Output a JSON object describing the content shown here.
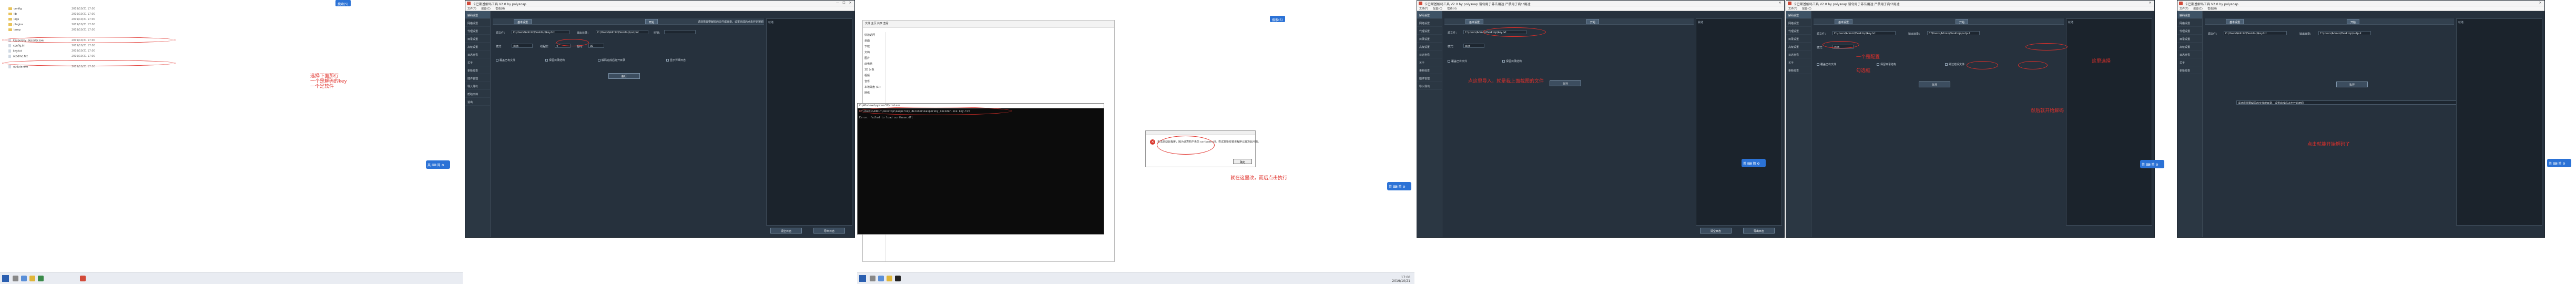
{
  "app": {
    "title": "卡巴斯基解码工具 V2.0 by polysoap",
    "title_alt": "卡巴斯基解码工具 V2.0 by polysoap    请勿用于非法用途 严禁用于商业用途",
    "menu": [
      "文件(F)",
      "配置(C)",
      "帮助(H)"
    ],
    "window_controls": [
      "—",
      "☐",
      "✕"
    ],
    "sidebar": [
      "解码设置",
      "网络设置",
      "代理设置",
      "目录设置",
      "高级设置",
      "日志查看",
      "关于",
      "更新检查",
      "插件管理",
      "导入导出",
      "帮助文档",
      "退出"
    ],
    "tab_label": "基本设置",
    "start_button": "开始",
    "section_hint": "请选择需要解码的文件或目录，设置完成后点击开始按钮",
    "label_source": "源文件：",
    "label_output": "输出目录：",
    "label_key": "密钥：",
    "label_mode": "模式：",
    "label_thread": "线程数：",
    "label_timeout": "超时：",
    "source_value": "C:\\Users\\Admin\\Desktop\\key.txt",
    "output_value": "C:\\Users\\Admin\\Desktop\\output",
    "key_value": "",
    "mode_value": "自动",
    "thread_value": "4",
    "timeout_value": "30",
    "checks": [
      "覆盖已有文件",
      "保留目录结构",
      "解码完成后打开目录",
      "显示详细日志",
      "跳过错误文件"
    ],
    "run_button": "执行",
    "log_buttons": [
      "清空日志",
      "导出日志"
    ],
    "log_text": "就绪"
  },
  "explorer": {
    "nav": [
      "快速访问",
      "桌面",
      "下载",
      "文档",
      "图片",
      "此电脑",
      "3D 对象",
      "视频",
      "音乐",
      "本地磁盘 (C:)",
      "网络"
    ],
    "ribbon": "文件   主页   共享   查看",
    "files": [
      {
        "name": "config",
        "date": "2019/10/21 17:00",
        "kind": "folder"
      },
      {
        "name": "lib",
        "date": "2019/10/21 17:00",
        "kind": "folder"
      },
      {
        "name": "logs",
        "date": "2019/10/21 17:00",
        "kind": "folder"
      },
      {
        "name": "plugins",
        "date": "2019/10/21 17:00",
        "kind": "folder"
      },
      {
        "name": "temp",
        "date": "2019/10/21 17:00",
        "kind": "folder"
      },
      {
        "name": "kaspersky_decoder.exe",
        "date": "2019/10/21 17:00",
        "kind": "file"
      },
      {
        "name": "config.ini",
        "date": "2019/10/21 17:00",
        "kind": "file"
      },
      {
        "name": "key.txt",
        "date": "2019/10/21 17:00",
        "kind": "file"
      },
      {
        "name": "readme.txt",
        "date": "2019/10/21 17:00",
        "kind": "file"
      },
      {
        "name": "update.exe",
        "date": "2019/10/21 17:00",
        "kind": "file"
      },
      {
        "name": "ucrtbase.dll",
        "date": "2019/10/21 17:00",
        "kind": "file"
      }
    ]
  },
  "annotations": {
    "n1": "选择下面那行\n一个是解码的key\n一个是软件",
    "n2": "就在这里改，而后点击执行",
    "n3": "点这里导入，就是我上面截图的文件",
    "n4": "一个是配置",
    "n5": "这里选择",
    "n6": "然后就开始解码",
    "n7": "勾选框",
    "n8": "点击就能开始解码了"
  },
  "cmd": {
    "title": "C:\\Windows\\system32\\cmd.exe",
    "line1": "C:\\Users\\Admin\\Desktop\\kaspersky_decoder>kaspersky_decoder.exe key.txt",
    "line2": "Error: failed to load ucrtbase.dll"
  },
  "dialog": {
    "message": "无法启动此程序，因为计算机中丢失 ucrtbase.dll。尝试重新安装该程序以解决此问题。",
    "ok": "确定"
  },
  "float_badge": "英 ⌨ 简 ⚙",
  "search_chip": "搜索(S)",
  "taskbar": {
    "time": "17:00",
    "date": "2019/10/21"
  },
  "colors": {
    "app_bg": "#26313d",
    "annotation": "#e0302a",
    "badge": "#2b72d6"
  }
}
